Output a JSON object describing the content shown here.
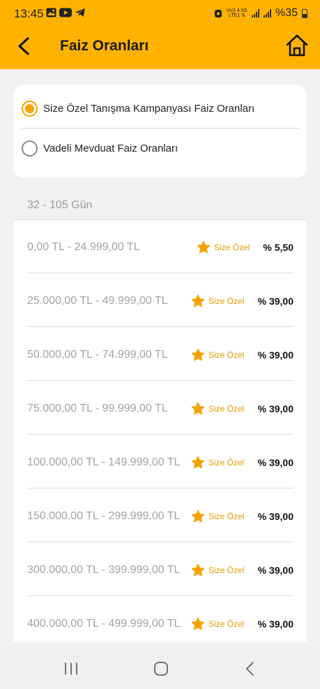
{
  "status_bar": {
    "time": "13:45",
    "network_top": "Vo)) 4.5G",
    "network_bottom": "LTE1 ⇅",
    "battery": "%35"
  },
  "header": {
    "title": "Faiz Oranları",
    "back_icon": "chevron-left-icon",
    "home_icon": "home-icon",
    "background": "#ffb300"
  },
  "rate_type": {
    "options": [
      {
        "label": "Size Özel Tanışma Kampanyası Faiz Oranları",
        "selected": true
      },
      {
        "label": "Vadeli Mevduat Faiz Oranları",
        "selected": false
      }
    ]
  },
  "term_range": "32 - 105 Gün",
  "rates": [
    {
      "range": "0,00 TL - 24.999,00 TL",
      "badge": "Size Özel",
      "rate": "% 5,50"
    },
    {
      "range": "25.000,00 TL - 49.999,00 TL",
      "badge": "Size Özel",
      "rate": "% 39,00"
    },
    {
      "range": "50.000,00 TL - 74.999,00 TL",
      "badge": "Size Özel",
      "rate": "% 39,00"
    },
    {
      "range": "75.000,00 TL - 99.999,00 TL",
      "badge": "Size Özel",
      "rate": "% 39,00"
    },
    {
      "range": "100.000,00 TL - 149.999,00 TL",
      "badge": "Size Özel",
      "rate": "% 39,00"
    },
    {
      "range": "150.000,00 TL - 299.999,00 TL",
      "badge": "Size Özel",
      "rate": "% 39,00"
    },
    {
      "range": "300.000,00 TL - 399.999,00 TL",
      "badge": "Size Özel",
      "rate": "% 39,00"
    },
    {
      "range": "400.000,00 TL - 499.999,00 TL",
      "badge": "Size Özel",
      "rate": "% 39,00"
    }
  ],
  "colors": {
    "accent": "#f5a300",
    "badge_text": "#e89a00"
  }
}
